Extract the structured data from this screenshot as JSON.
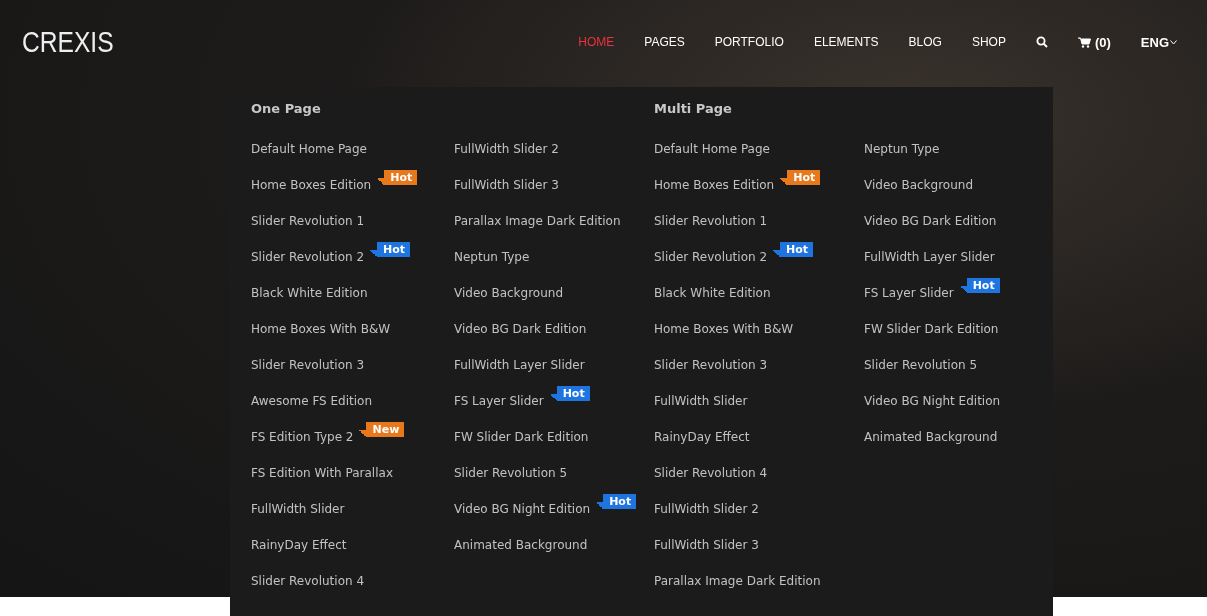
{
  "logo": "CREXIS",
  "nav": [
    {
      "label": "HOME",
      "selected": true
    },
    {
      "label": "PAGES",
      "selected": false
    },
    {
      "label": "PORTFOLIO",
      "selected": false
    },
    {
      "label": "ELEMENTS",
      "selected": false
    },
    {
      "label": "BLOG",
      "selected": false
    },
    {
      "label": "SHOP",
      "selected": false
    }
  ],
  "cart": "(0)",
  "language": "ENG",
  "menu_sections": [
    {
      "title": "One Page",
      "columns": [
        [
          {
            "label": "Default Home Page"
          },
          {
            "label": "Home Boxes Edition",
            "badge": {
              "text": "Hot",
              "color": "#e8781c"
            }
          },
          {
            "label": "Slider Revolution 1"
          },
          {
            "label": "Slider Revolution 2",
            "badge": {
              "text": "Hot",
              "color": "#1f75e0"
            }
          },
          {
            "label": "Black White Edition"
          },
          {
            "label": "Home Boxes With B&W"
          },
          {
            "label": "Slider Revolution 3"
          },
          {
            "label": "Awesome FS Edition"
          },
          {
            "label": "FS Edition Type 2",
            "badge": {
              "text": "New",
              "color": "#e8781c"
            }
          },
          {
            "label": "FS Edition With Parallax"
          },
          {
            "label": "FullWidth Slider"
          },
          {
            "label": "RainyDay Effect"
          },
          {
            "label": "Slider Revolution 4"
          }
        ],
        [
          {
            "label": "FullWidth Slider 2"
          },
          {
            "label": "FullWidth Slider 3"
          },
          {
            "label": "Parallax Image Dark Edition"
          },
          {
            "label": "Neptun Type"
          },
          {
            "label": "Video Background"
          },
          {
            "label": "Video BG Dark Edition"
          },
          {
            "label": "FullWidth Layer Slider"
          },
          {
            "label": "FS Layer Slider",
            "badge": {
              "text": "Hot",
              "color": "#1f75e0"
            }
          },
          {
            "label": "FW Slider Dark Edition"
          },
          {
            "label": "Slider Revolution 5"
          },
          {
            "label": "Video BG Night Edition",
            "badge": {
              "text": "Hot",
              "color": "#1f75e0"
            }
          },
          {
            "label": "Animated Background"
          }
        ]
      ]
    },
    {
      "title": "Multi Page",
      "columns": [
        [
          {
            "label": "Default Home Page"
          },
          {
            "label": "Home Boxes Edition",
            "badge": {
              "text": "Hot",
              "color": "#e8781c"
            }
          },
          {
            "label": "Slider Revolution 1"
          },
          {
            "label": "Slider Revolution 2",
            "badge": {
              "text": "Hot",
              "color": "#1f75e0"
            }
          },
          {
            "label": "Black White Edition"
          },
          {
            "label": "Home Boxes With B&W"
          },
          {
            "label": "Slider Revolution 3"
          },
          {
            "label": "FullWidth Slider"
          },
          {
            "label": "RainyDay Effect"
          },
          {
            "label": "Slider Revolution 4"
          },
          {
            "label": "FullWidth Slider 2"
          },
          {
            "label": "FullWidth Slider 3"
          },
          {
            "label": "Parallax Image Dark Edition"
          }
        ],
        [
          {
            "label": "Neptun Type"
          },
          {
            "label": "Video Background"
          },
          {
            "label": "Video BG Dark Edition"
          },
          {
            "label": "FullWidth Layer Slider"
          },
          {
            "label": "FS Layer Slider",
            "badge": {
              "text": "Hot",
              "color": "#1f75e0"
            }
          },
          {
            "label": "FW Slider Dark Edition"
          },
          {
            "label": "Slider Revolution 5"
          },
          {
            "label": "Video BG Night Edition"
          },
          {
            "label": "Animated Background"
          }
        ]
      ]
    }
  ]
}
